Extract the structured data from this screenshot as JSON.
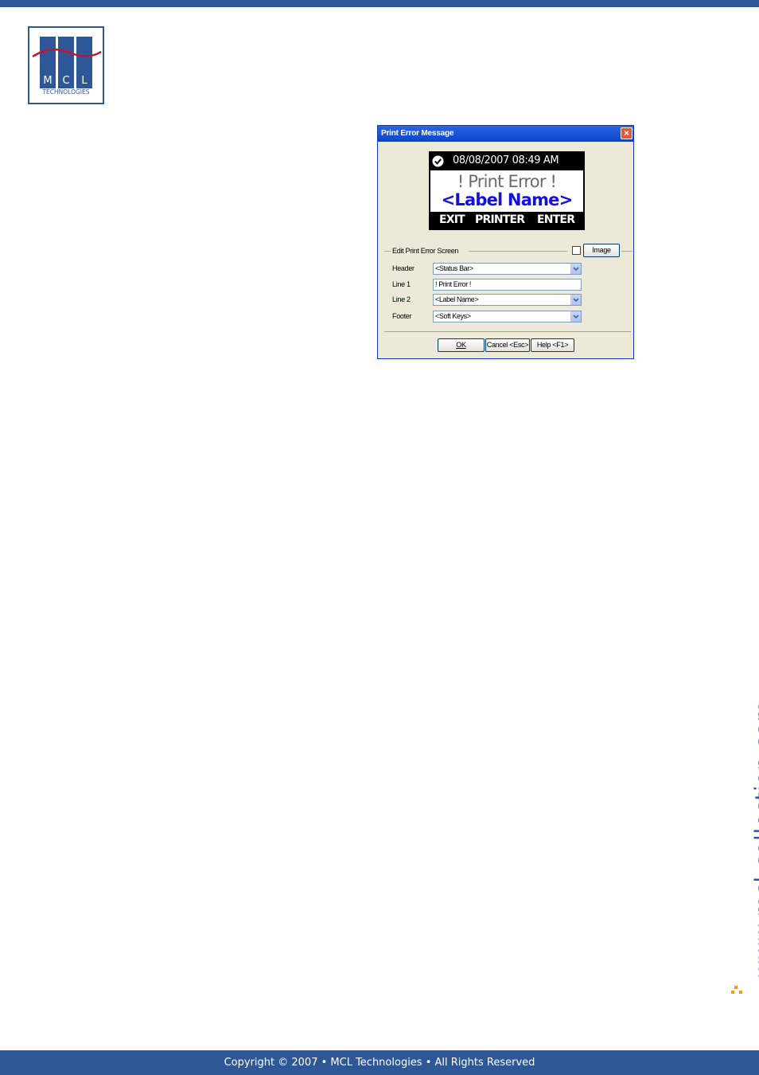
{
  "colors": {
    "brand": "#2e5797",
    "accent": "#f0a000",
    "dialog_title": "#0846c8",
    "lcd_blue": "#1212e0"
  },
  "logo": {
    "letters": [
      "M",
      "C",
      "L"
    ],
    "subtitle": "TECHNOLOGIES"
  },
  "dialog": {
    "title": "Print Error Message",
    "close_label": "×",
    "preview": {
      "status_icon": "check-circle-icon",
      "datetime": "08/08/2007 08:49 AM",
      "line1": "! Print Error !",
      "line2": "<Label Name>",
      "softkeys": [
        "EXIT",
        "PRINTER",
        "ENTER"
      ]
    },
    "group_label": "Edit Print Error Screen",
    "image_checked": false,
    "image_button": "Image",
    "fields": {
      "header": {
        "label": "Header",
        "value": "<Status Bar>"
      },
      "line1": {
        "label": "Line 1",
        "value": "! Print Error !"
      },
      "line2": {
        "label": "Line 2",
        "value": "<Label Name>"
      },
      "footer": {
        "label": "Footer",
        "value": "<Soft Keys>"
      }
    },
    "buttons": {
      "ok": "OK",
      "cancel": "Cancel <Esc>",
      "help": "Help <F1>"
    }
  },
  "side_url": "www.mcl-collection.com",
  "footer": {
    "copyright": "Copyright © 2007 • MCL Technologies • All Rights Reserved"
  }
}
